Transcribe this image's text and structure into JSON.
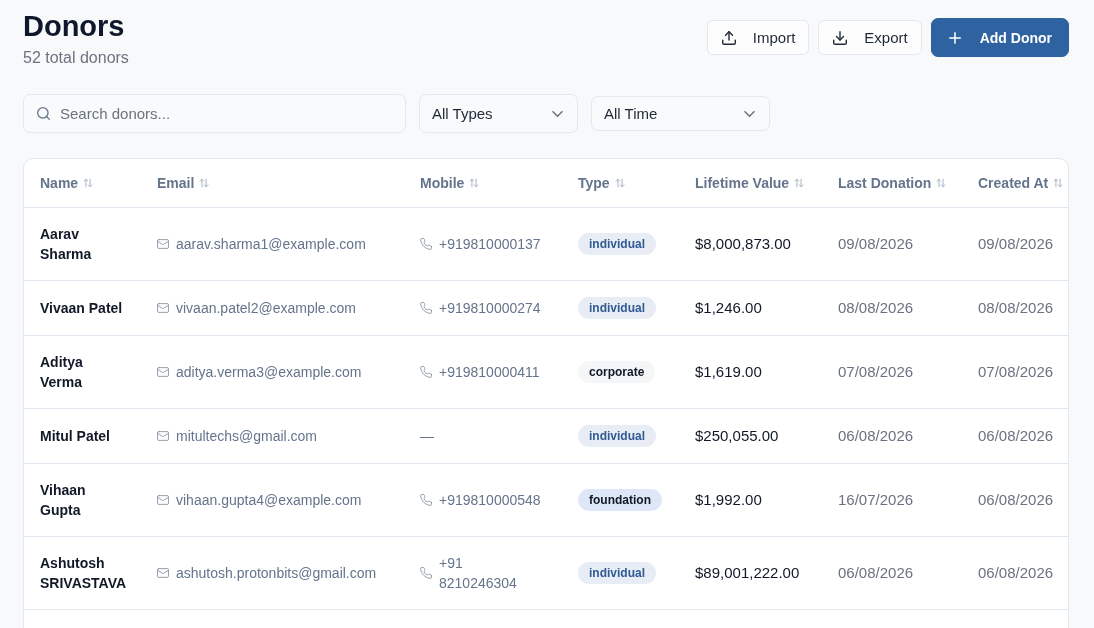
{
  "header": {
    "title": "Donors",
    "subtitle": "52 total donors"
  },
  "actions": [
    {
      "label": "Import",
      "kind": "upload"
    },
    {
      "label": "Export",
      "kind": "download"
    },
    {
      "label": "Add Donor",
      "kind": "add"
    }
  ],
  "filters": {
    "search": {
      "placeholder": "Search donors..."
    },
    "dropdowns": [
      {
        "value": "All Types"
      },
      {
        "value": "All Time"
      }
    ]
  },
  "table": {
    "columns": [
      {
        "label": "Name",
        "sortable": true
      },
      {
        "label": "Email",
        "sortable": true
      },
      {
        "label": "Mobile",
        "sortable": true
      },
      {
        "label": "Type",
        "sortable": true
      },
      {
        "label": "Lifetime Value",
        "sortable": true
      },
      {
        "label": "Last Donation",
        "sortable": true
      },
      {
        "label": "Created At",
        "sortable": true
      }
    ],
    "rows": [
      {
        "name": "Aarav Sharma",
        "email": "aarav.sharma1@example.com",
        "mobile": {
          "kind": "phone",
          "text": "+919810000137"
        },
        "type": {
          "kind": "individual",
          "label": "individual"
        },
        "lifetime_value": "$8,000,873.00",
        "last_donation": "09/08/2026",
        "created_at": "09/08/2026"
      },
      {
        "name": "Vivaan Patel",
        "email": "vivaan.patel2@example.com",
        "mobile": {
          "kind": "phone",
          "text": "+919810000274"
        },
        "type": {
          "kind": "individual",
          "label": "individual"
        },
        "lifetime_value": "$1,246.00",
        "last_donation": "08/08/2026",
        "created_at": "08/08/2026"
      },
      {
        "name": "Aditya Verma",
        "email": "aditya.verma3@example.com",
        "mobile": {
          "kind": "phone",
          "text": "+919810000411"
        },
        "type": {
          "kind": "corporate",
          "label": "corporate"
        },
        "lifetime_value": "$1,619.00",
        "last_donation": "07/08/2026",
        "created_at": "07/08/2026"
      },
      {
        "name": "Mitul Patel",
        "email": "mitultechs@gmail.com",
        "mobile": {
          "kind": "none",
          "text": "—"
        },
        "type": {
          "kind": "individual",
          "label": "individual"
        },
        "lifetime_value": "$250,055.00",
        "last_donation": "06/08/2026",
        "created_at": "06/08/2026"
      },
      {
        "name": "Vihaan Gupta",
        "email": "vihaan.gupta4@example.com",
        "mobile": {
          "kind": "phone",
          "text": "+919810000548"
        },
        "type": {
          "kind": "foundation",
          "label": "foundation"
        },
        "lifetime_value": "$1,992.00",
        "last_donation": "16/07/2026",
        "created_at": "06/08/2026"
      },
      {
        "name": "Ashutosh SRIVASTAVA",
        "email": "ashutosh.protonbits@gmail.com",
        "mobile": {
          "kind": "phone",
          "text": "+91 8210246304"
        },
        "type": {
          "kind": "individual",
          "label": "individual"
        },
        "lifetime_value": "$89,001,222.00",
        "last_donation": "06/08/2026",
        "created_at": "06/08/2026"
      }
    ]
  }
}
